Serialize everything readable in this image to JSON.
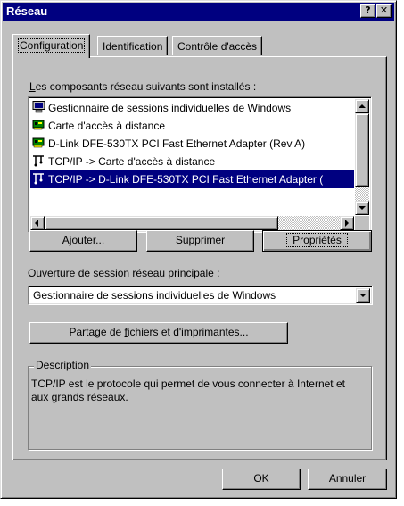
{
  "window": {
    "title": "Réseau"
  },
  "titlebar": {
    "help": "?",
    "close": "✕"
  },
  "tabs": [
    {
      "label": "Configuration",
      "active": true
    },
    {
      "label": "Identification",
      "active": false
    },
    {
      "label": "Contrôle d'accès",
      "active": false
    }
  ],
  "components": {
    "label_prefix": "L",
    "label_rest": "es composants réseau suivants sont installés :",
    "items": [
      {
        "icon": "monitor-icon",
        "label": "Gestionnaire de sessions individuelles de Windows"
      },
      {
        "icon": "network-card-icon",
        "label": "Carte d'accès à distance"
      },
      {
        "icon": "network-card-icon",
        "label": "D-Link DFE-530TX PCI Fast Ethernet Adapter (Rev A)"
      },
      {
        "icon": "protocol-icon",
        "label": "TCP/IP -> Carte d'accès à distance"
      },
      {
        "icon": "protocol-icon",
        "label": "TCP/IP -> D-Link DFE-530TX PCI Fast Ethernet Adapter (",
        "selected": true
      }
    ]
  },
  "buttons": {
    "add_pre": "Aj",
    "add_u": "o",
    "add_post": "uter...",
    "remove_u": "S",
    "remove_post": "upprimer",
    "props_u": "P",
    "props_post": "ropriétés"
  },
  "logon": {
    "label_pre": "Ouverture de s",
    "label_u": "e",
    "label_post": "ssion réseau principale :",
    "value": "Gestionnaire de sessions individuelles de Windows"
  },
  "sharing": {
    "pre": "Partage de ",
    "u": "f",
    "post": "ichiers et d'imprimantes..."
  },
  "description": {
    "title": "Description",
    "text": "TCP/IP est le protocole qui permet de vous connecter à Internet et aux grands réseaux."
  },
  "footer": {
    "ok": "OK",
    "cancel": "Annuler"
  }
}
